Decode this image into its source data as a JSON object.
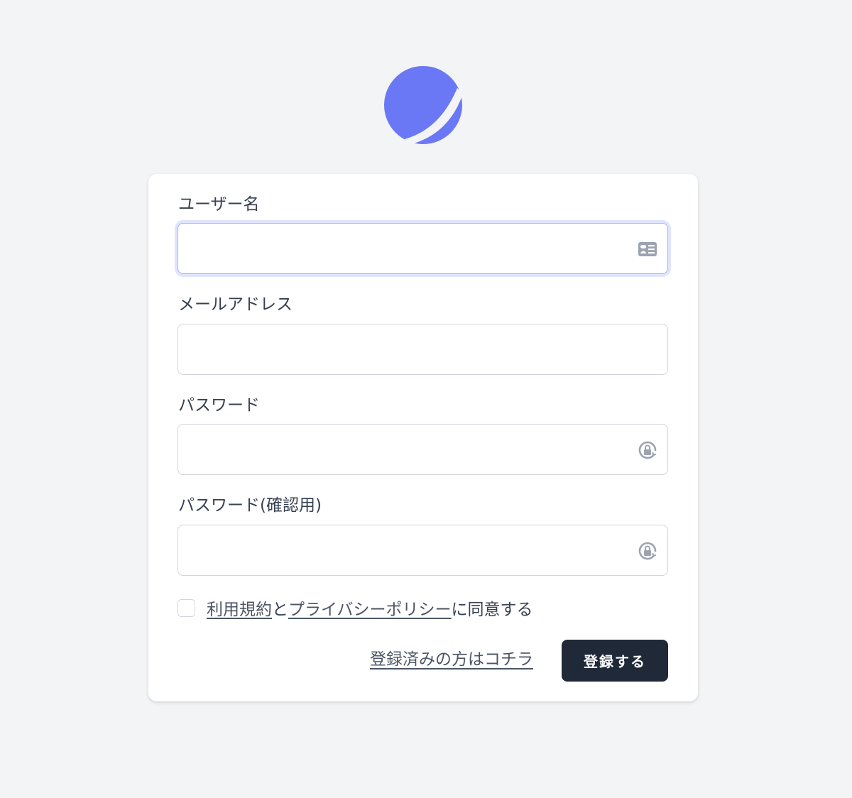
{
  "logo": {
    "icon": "planet-logo",
    "color": "#6b78f5"
  },
  "form": {
    "fields": [
      {
        "label": "ユーザー名",
        "value": "",
        "placeholder": "",
        "icon": "id-card-icon",
        "focused": true
      },
      {
        "label": "メールアドレス",
        "value": "",
        "placeholder": ""
      },
      {
        "label": "パスワード",
        "value": "",
        "placeholder": "",
        "icon": "password-lock-icon"
      },
      {
        "label": "パスワード(確認用)",
        "value": "",
        "placeholder": "",
        "icon": "password-lock-icon"
      }
    ],
    "agreement": {
      "checked": false,
      "terms_link": "利用規約",
      "connector": "と",
      "privacy_link": "プライバシーポリシー",
      "suffix": "に同意する"
    },
    "login_link": "登録済みの方はコチラ",
    "submit_label": "登録する"
  },
  "colors": {
    "background": "#f3f4f6",
    "card": "#ffffff",
    "button": "#1f2937",
    "focus_ring": "#a5b4fc",
    "accent": "#6b78f5"
  }
}
